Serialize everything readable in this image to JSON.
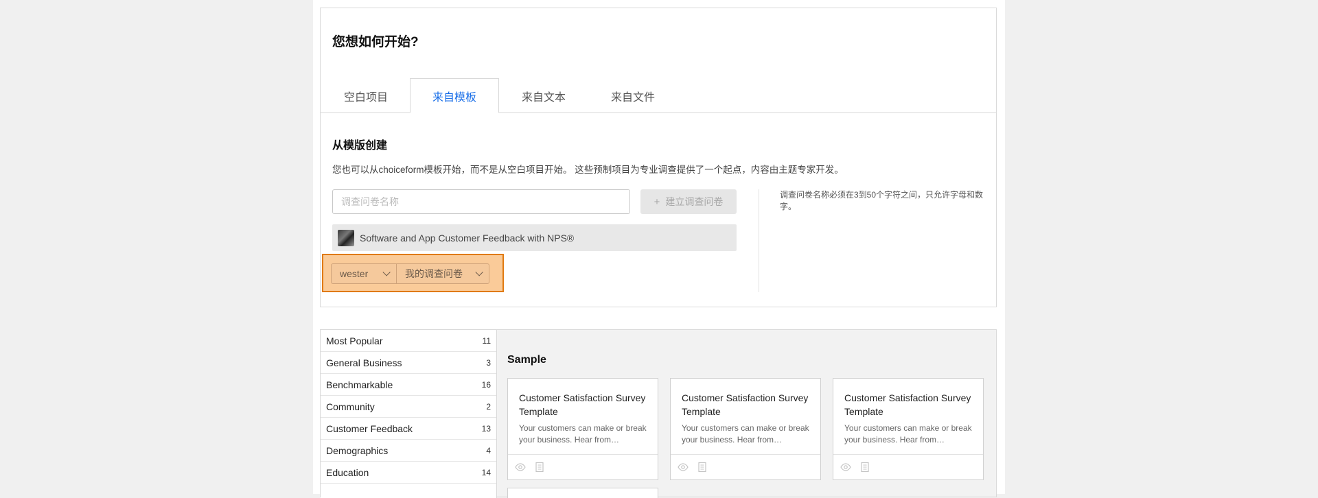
{
  "panel": {
    "title": "您想如何开始?",
    "tabs": [
      {
        "label": "空白项目"
      },
      {
        "label": "来自模板"
      },
      {
        "label": "来自文本"
      },
      {
        "label": "来自文件"
      }
    ],
    "active_tab_color": "#1a6fe8",
    "section_title": "从模版创建",
    "section_desc": "您也可以从choiceform模板开始，而不是从空白项目开始。 这些预制项目为专业调查提供了一个起点，内容由主题专家开发。",
    "name_input": {
      "value": "",
      "placeholder": "调查问卷名称"
    },
    "create_button": {
      "label": "建立调查问卷",
      "icon": "plus-icon"
    },
    "template_selected": "Software and App Customer Feedback with NPS®",
    "owner_dropdown": "wester",
    "folder_dropdown": "我的调查问卷",
    "hint": "调查问卷名称必须在3到50个字符之间，只允许字母和数字。",
    "highlight_color": "#e07a10"
  },
  "categories": [
    {
      "label": "Most Popular",
      "count": "11"
    },
    {
      "label": "General Business",
      "count": "3"
    },
    {
      "label": "Benchmarkable",
      "count": "16"
    },
    {
      "label": "Community",
      "count": "2"
    },
    {
      "label": "Customer Feedback",
      "count": "13"
    },
    {
      "label": "Demographics",
      "count": "4"
    },
    {
      "label": "Education",
      "count": "14"
    }
  ],
  "sample": {
    "title": "Sample",
    "cards": [
      {
        "title": "Customer Satisfaction Survey Template",
        "desc": "Your customers can make or break your business. Hear from…"
      },
      {
        "title": "Customer Satisfaction Survey Template",
        "desc": "Your customers can make or break your business. Hear from…"
      },
      {
        "title": "Customer Satisfaction Survey Template",
        "desc": "Your customers can make or break your business. Hear from…"
      }
    ]
  }
}
